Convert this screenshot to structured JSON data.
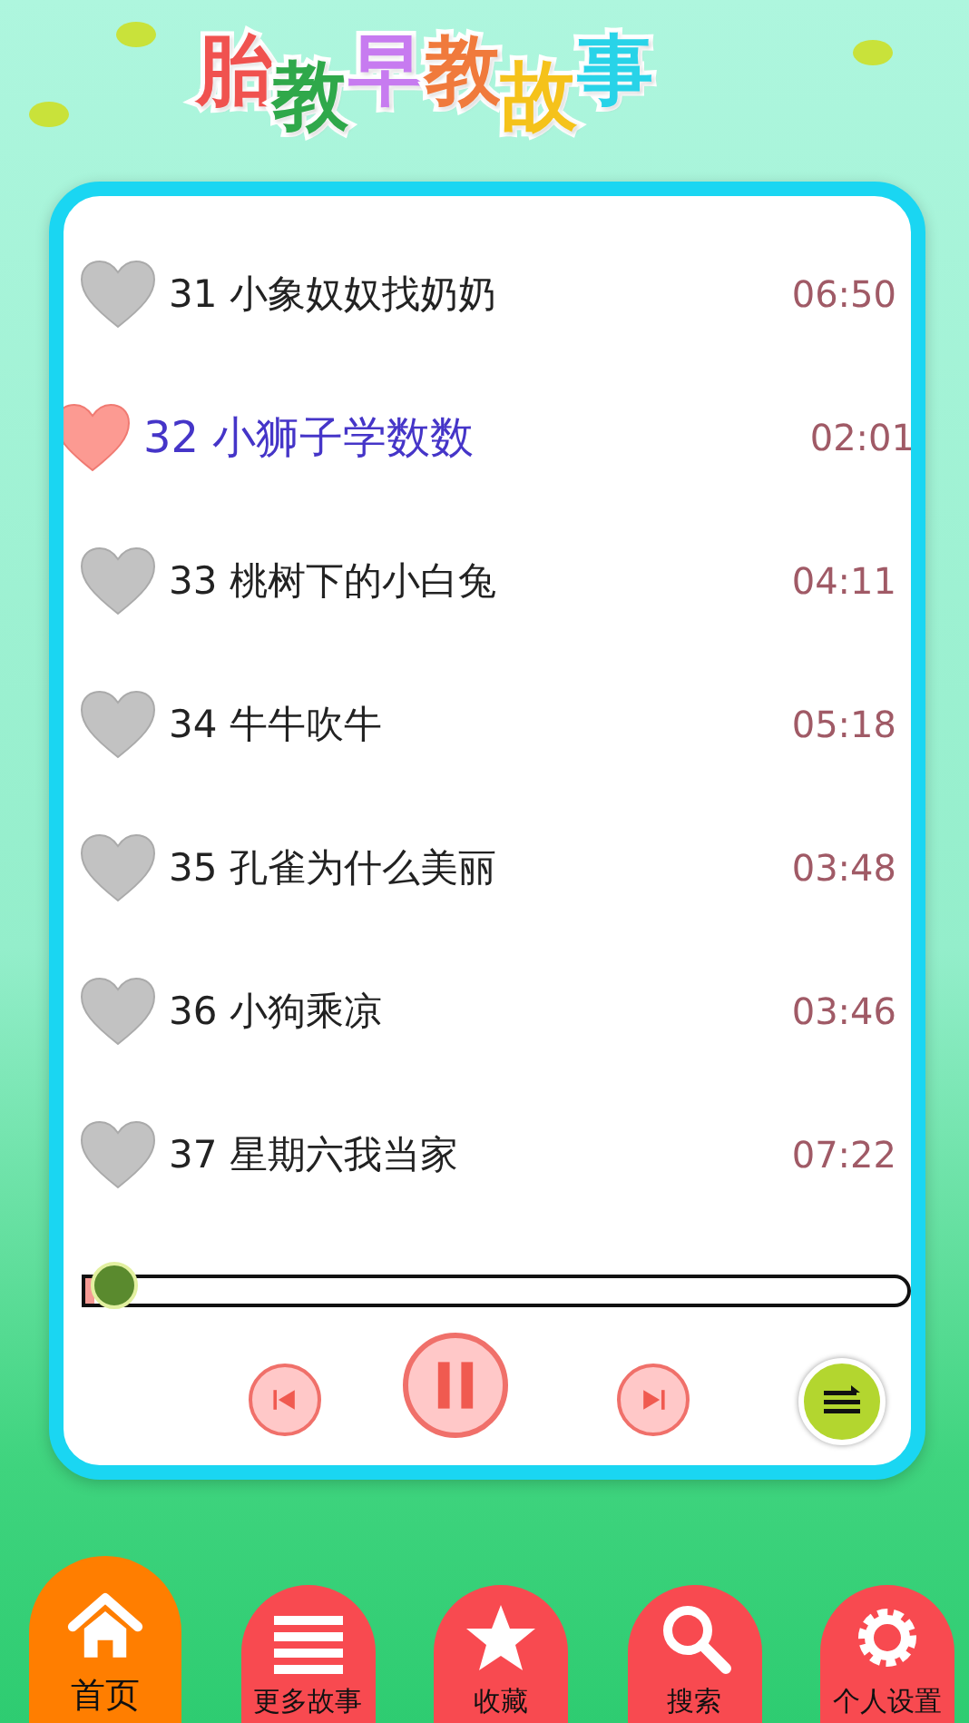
{
  "title": "胎教早教故事",
  "stories": [
    {
      "number": "31",
      "title": "小象奴奴找奶奶",
      "duration": "06:50",
      "selected": false
    },
    {
      "number": "32",
      "title": "小狮子学数数",
      "duration": "02:01",
      "selected": true
    },
    {
      "number": "33",
      "title": "桃树下的小白兔",
      "duration": "04:11",
      "selected": false
    },
    {
      "number": "34",
      "title": "牛牛吹牛",
      "duration": "05:18",
      "selected": false
    },
    {
      "number": "35",
      "title": "孔雀为什么美丽",
      "duration": "03:48",
      "selected": false
    },
    {
      "number": "36",
      "title": "小狗乘凉",
      "duration": "03:46",
      "selected": false
    },
    {
      "number": "37",
      "title": "星期六我当家",
      "duration": "07:22",
      "selected": false
    }
  ],
  "player": {
    "level": 0.01,
    "playing": true
  },
  "nav": [
    {
      "kind": "home",
      "label": "首页",
      "selected": true
    },
    {
      "kind": "list",
      "label": "更多故事",
      "selected": false
    },
    {
      "kind": "star",
      "label": "收藏",
      "selected": false
    },
    {
      "kind": "search",
      "label": "搜索",
      "selected": false
    },
    {
      "kind": "gear",
      "label": "个人设置",
      "selected": false
    }
  ]
}
